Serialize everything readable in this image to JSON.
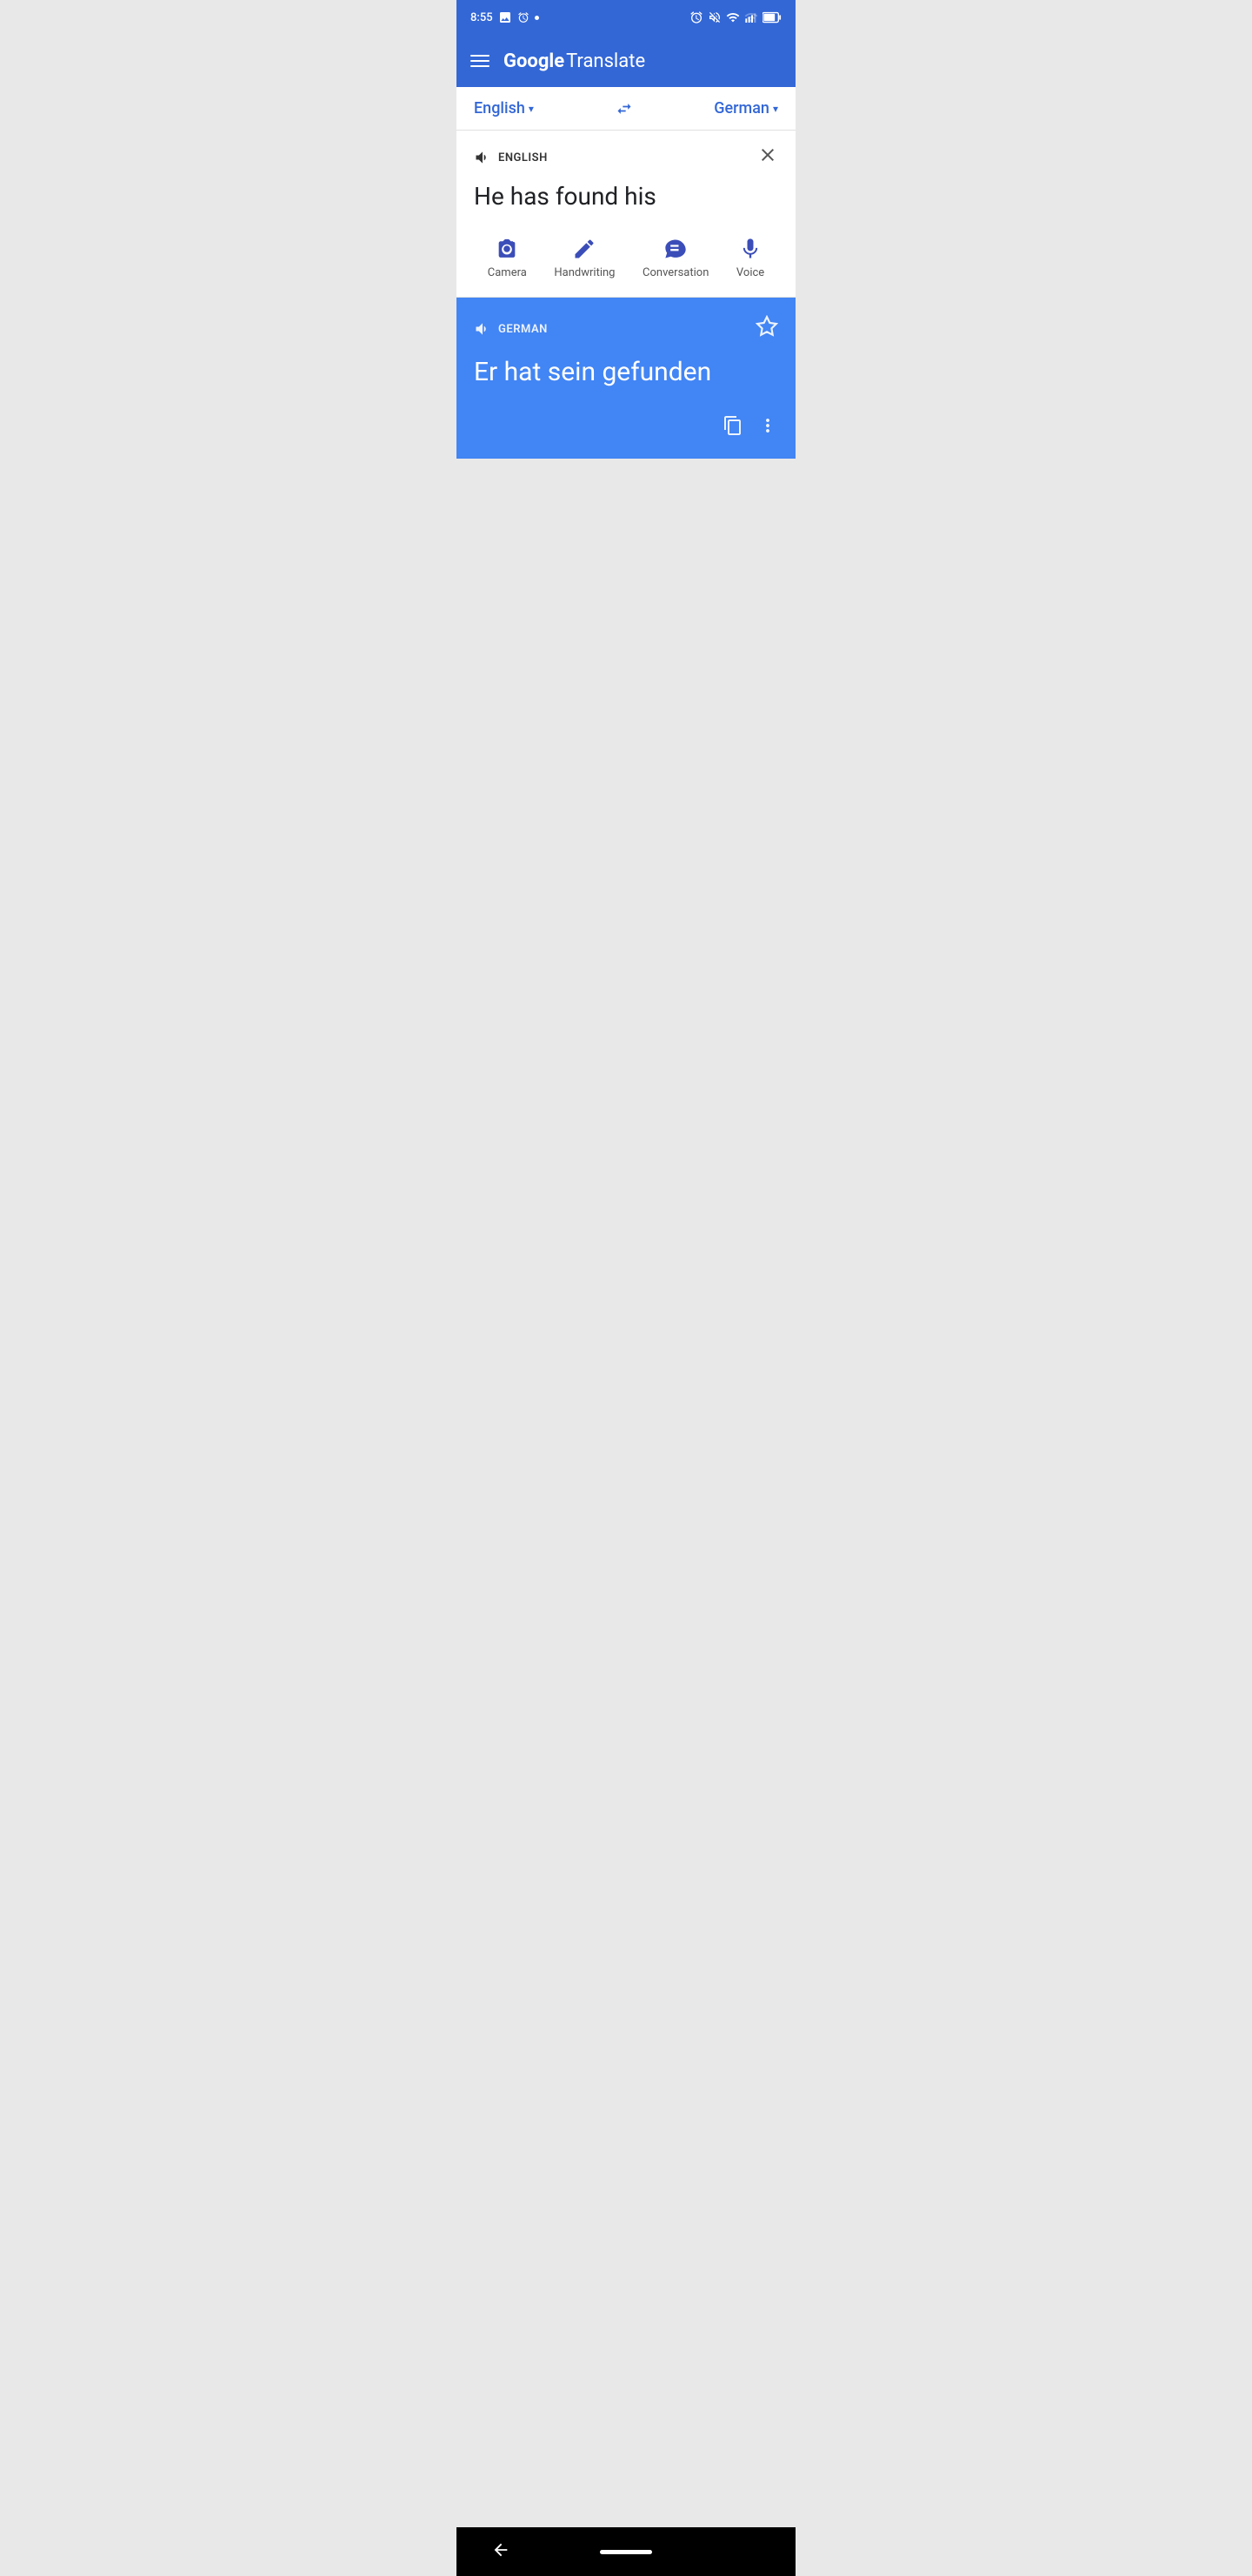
{
  "status_bar": {
    "time": "8:55",
    "icons_right": [
      "alarm",
      "muted",
      "wifi",
      "signal",
      "battery"
    ]
  },
  "app_bar": {
    "menu_label": "Menu",
    "title_google": "Google",
    "title_rest": " Translate"
  },
  "language_selector": {
    "source_lang": "English",
    "target_lang": "German",
    "swap_label": "Swap languages"
  },
  "input_section": {
    "lang_label": "ENGLISH",
    "input_text": "He has found his",
    "close_label": "Clear"
  },
  "action_buttons": [
    {
      "id": "camera",
      "label": "Camera"
    },
    {
      "id": "handwriting",
      "label": "Handwriting"
    },
    {
      "id": "conversation",
      "label": "Conversation"
    },
    {
      "id": "voice",
      "label": "Voice"
    }
  ],
  "translation_section": {
    "lang_label": "GERMAN",
    "translation_text": "Er hat sein gefunden",
    "favorite_label": "Save to favorites",
    "copy_label": "Copy",
    "more_label": "More options"
  },
  "nav_bar": {
    "back_label": "Back"
  }
}
